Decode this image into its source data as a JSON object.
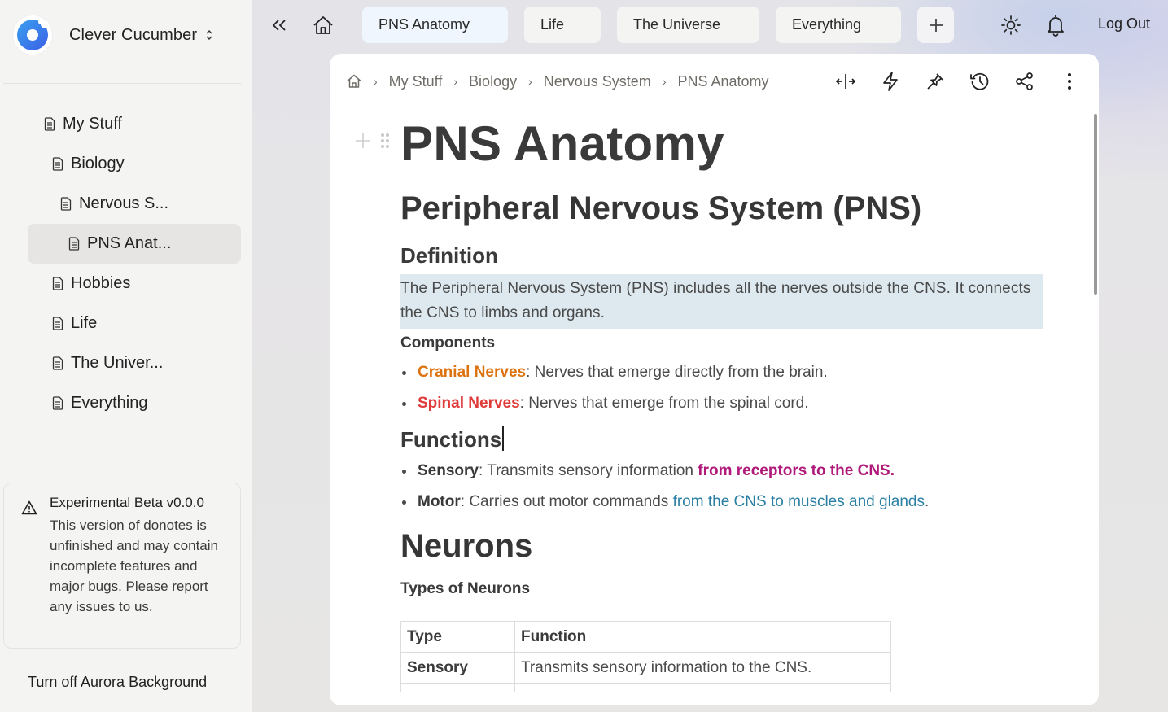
{
  "workspace": {
    "name": "Clever Cucumber",
    "switch_icon": "chevron-up-down-icon",
    "logo_icon": "donut-logo-icon"
  },
  "sidebar": {
    "items": [
      {
        "label": "My Stuff",
        "depth": 0,
        "icon": "document-icon",
        "active": false
      },
      {
        "label": "Biology",
        "depth": 1,
        "icon": "document-icon",
        "active": false
      },
      {
        "label": "Nervous S...",
        "depth": 2,
        "icon": "document-icon",
        "active": false
      },
      {
        "label": "PNS Anat...",
        "depth": 3,
        "icon": "document-icon",
        "active": true
      },
      {
        "label": "Hobbies",
        "depth": 1,
        "icon": "document-icon",
        "active": false
      },
      {
        "label": "Life",
        "depth": 1,
        "icon": "document-icon",
        "active": false
      },
      {
        "label": "The Univer...",
        "depth": 1,
        "icon": "document-icon",
        "active": false
      },
      {
        "label": "Everything",
        "depth": 1,
        "icon": "document-icon",
        "active": false
      }
    ],
    "beta_notice": {
      "title": "Experimental Beta v0.0.0",
      "body": "This version of donotes is unfinished and may contain incomplete features and major bugs. Please report any issues to us.",
      "icon": "warning-icon"
    },
    "aurora_toggle": "Turn off Aurora Background"
  },
  "topbar": {
    "collapse_icon": "double-chevron-left-icon",
    "home_icon": "home-icon",
    "tabs": [
      {
        "label": "PNS Anatomy",
        "active": true
      },
      {
        "label": "Life",
        "active": false
      },
      {
        "label": "The Universe",
        "active": false
      },
      {
        "label": "Everything",
        "active": false
      }
    ],
    "add_tab_icon": "plus-icon",
    "theme_icon": "sun-icon",
    "notifications_icon": "bell-icon",
    "logout_label": "Log Out"
  },
  "document": {
    "breadcrumb": [
      "My Stuff",
      "Biology",
      "Nervous System",
      "PNS Anatomy"
    ],
    "toolbar_icons": [
      "expand-width-icon",
      "lightning-icon",
      "pin-icon",
      "history-icon",
      "share-icon",
      "more-vertical-icon"
    ],
    "title": "PNS Anatomy",
    "heading1": "Peripheral Nervous System (PNS)",
    "definition_heading": "Definition",
    "definition_text": "The Peripheral Nervous System (PNS) includes all the nerves outside the CNS. It connects the CNS to limbs and organs.",
    "definition_highlight_color": "#dde9ef",
    "components_heading": "Components",
    "components": [
      {
        "term": "Cranial Nerves",
        "term_color": "#dd730f",
        "text": ": Nerves that emerge directly from the brain."
      },
      {
        "term": "Spinal Nerves",
        "term_color": "#e03b3b",
        "text": ": Nerves that emerge from the spinal cord."
      }
    ],
    "functions_heading": "Functions",
    "functions": [
      {
        "term": "Sensory",
        "text": ": Transmits sensory information ",
        "colored": "from receptors to the CNS.",
        "colored_color": "#b0197a",
        "tail": ""
      },
      {
        "term": "Motor",
        "text": ": Carries out motor commands ",
        "colored": "from the CNS to muscles and glands",
        "colored_color": "#2a7fa5",
        "tail": "."
      }
    ],
    "neurons_heading": "Neurons",
    "neuron_types_heading": "Types of Neurons",
    "neuron_table": {
      "headers": [
        "Type",
        "Function"
      ],
      "rows": [
        [
          "Sensory",
          "Transmits sensory information to the CNS."
        ]
      ]
    }
  }
}
